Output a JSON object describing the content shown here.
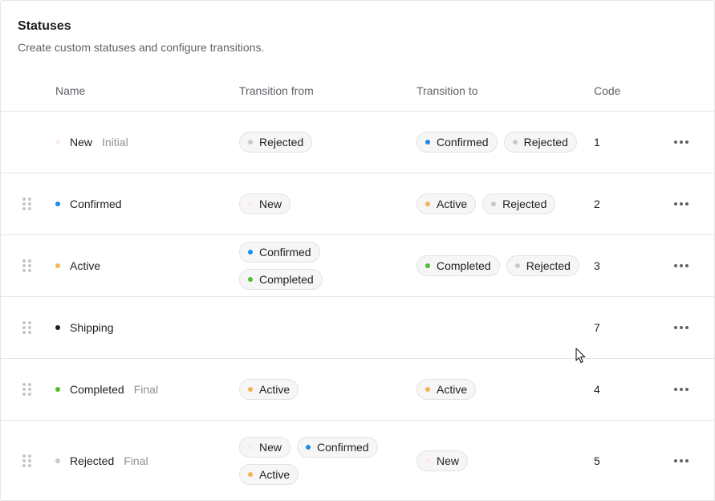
{
  "header": {
    "title": "Statuses",
    "subtitle": "Create custom statuses and configure transitions."
  },
  "columns": {
    "name": "Name",
    "from": "Transition from",
    "to": "Transition to",
    "code": "Code"
  },
  "colors": {
    "New": "#fbe9ee",
    "Confirmed": "#1a8ce8",
    "Active": "#f1b552",
    "Shipping": "#1f1f1f",
    "Completed": "#4cbf2a",
    "Rejected": "#c8c9cb"
  },
  "icons": {
    "drag": "drag-handle-icon",
    "more": "more-horizontal-icon",
    "cursor": "mouse-pointer-icon"
  },
  "rows": [
    {
      "name": "New",
      "tag": "Initial",
      "from": [
        "Rejected"
      ],
      "to": [
        "Confirmed",
        "Rejected"
      ],
      "code": "1",
      "draggable": false
    },
    {
      "name": "Confirmed",
      "tag": "",
      "from": [
        "New"
      ],
      "to": [
        "Active",
        "Rejected"
      ],
      "code": "2",
      "draggable": true
    },
    {
      "name": "Active",
      "tag": "",
      "from": [
        "Confirmed",
        "Completed"
      ],
      "to": [
        "Completed",
        "Rejected"
      ],
      "code": "3",
      "draggable": true
    },
    {
      "name": "Shipping",
      "tag": "",
      "from": [],
      "to": [],
      "code": "7",
      "draggable": true
    },
    {
      "name": "Completed",
      "tag": "Final",
      "from": [
        "Active"
      ],
      "to": [
        "Active"
      ],
      "code": "4",
      "draggable": true
    },
    {
      "name": "Rejected",
      "tag": "Final",
      "from": [
        "New",
        "Confirmed",
        "Active"
      ],
      "to": [
        "New"
      ],
      "code": "5",
      "draggable": true
    }
  ]
}
